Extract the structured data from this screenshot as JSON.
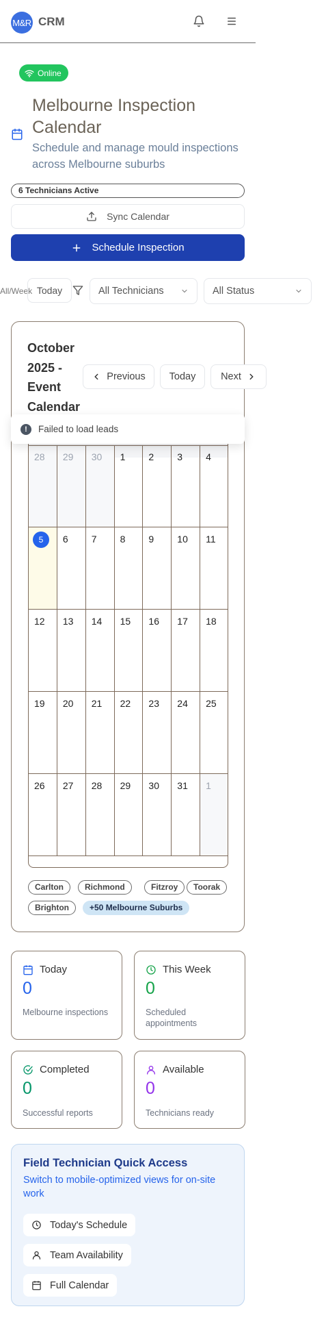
{
  "header": {
    "logo_text": "M&R",
    "brand": "CRM",
    "bell_icon": "bell-icon",
    "menu_icon": "hamburger-menu-icon"
  },
  "status": {
    "online_label": "Online"
  },
  "page": {
    "title": "Melbourne Inspection Calendar",
    "subtitle": "Schedule and manage mould inspections across Melbourne suburbs",
    "technicians_badge": "6 Technicians Active"
  },
  "actions": {
    "sync_label": "Sync Calendar",
    "schedule_label": "Schedule Inspection"
  },
  "filters": {
    "clipped_label": "All/Week",
    "today_label": "Today",
    "technician_select": "All Technicians",
    "status_select": "All Status"
  },
  "calendar": {
    "month_title": "October 2025 - Event Calendar",
    "prev_label": "Previous",
    "today_label": "Today",
    "next_label": "Next",
    "error_message": "Failed to load leads",
    "today_day": "5",
    "weeks": [
      [
        {
          "d": "28",
          "o": true
        },
        {
          "d": "29",
          "o": true
        },
        {
          "d": "30",
          "o": true
        },
        {
          "d": "1"
        },
        {
          "d": "2"
        },
        {
          "d": "3"
        },
        {
          "d": "4"
        }
      ],
      [
        {
          "d": "5",
          "t": true
        },
        {
          "d": "6"
        },
        {
          "d": "7"
        },
        {
          "d": "8"
        },
        {
          "d": "9"
        },
        {
          "d": "10"
        },
        {
          "d": "11"
        }
      ],
      [
        {
          "d": "12"
        },
        {
          "d": "13"
        },
        {
          "d": "14"
        },
        {
          "d": "15"
        },
        {
          "d": "16"
        },
        {
          "d": "17"
        },
        {
          "d": "18"
        }
      ],
      [
        {
          "d": "19"
        },
        {
          "d": "20"
        },
        {
          "d": "21"
        },
        {
          "d": "22"
        },
        {
          "d": "23"
        },
        {
          "d": "24"
        },
        {
          "d": "25"
        }
      ],
      [
        {
          "d": "26"
        },
        {
          "d": "27"
        },
        {
          "d": "28"
        },
        {
          "d": "29"
        },
        {
          "d": "30"
        },
        {
          "d": "31"
        },
        {
          "d": "1",
          "o": true
        }
      ]
    ]
  },
  "suburbs": {
    "items": [
      "Carlton",
      "Richmond",
      "Fitzroy",
      "Toorak",
      "Brighton"
    ],
    "more_label": "+50 Melbourne Suburbs"
  },
  "stats": {
    "today": {
      "label": "Today",
      "value": "0",
      "desc": "Melbourne inspections",
      "color": "#2563eb"
    },
    "week": {
      "label": "This Week",
      "value": "0",
      "desc": "Scheduled appointments",
      "color": "#16a34a"
    },
    "completed": {
      "label": "Completed",
      "value": "0",
      "desc": "Successful reports",
      "color": "#059669"
    },
    "available": {
      "label": "Available",
      "value": "0",
      "desc": "Technicians ready",
      "color": "#9333ea"
    }
  },
  "quick_access": {
    "title": "Field Technician Quick Access",
    "subtitle": "Switch to mobile-optimized views for on-site work",
    "schedule_label": "Today's Schedule",
    "team_label": "Team Availability",
    "calendar_label": "Full Calendar"
  }
}
